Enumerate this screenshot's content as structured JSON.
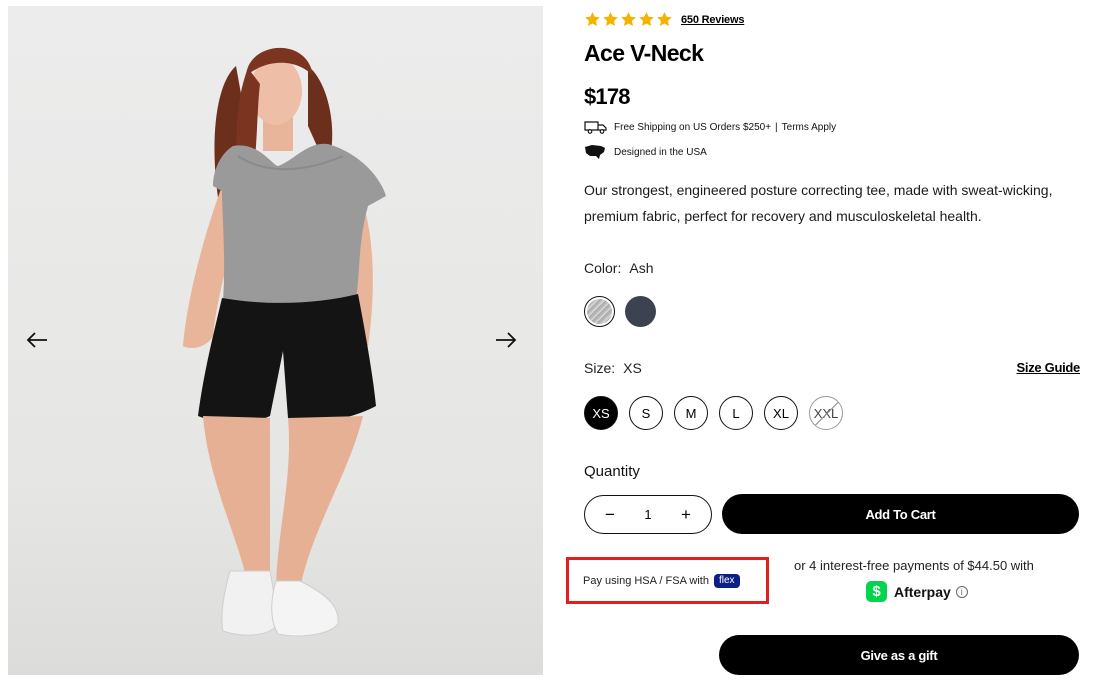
{
  "product": {
    "rating_stars": 5,
    "reviews_label": "650 Reviews",
    "title": "Ace V-Neck",
    "price": "$178",
    "shipping": {
      "text": "Free Shipping on US Orders $250+",
      "separator": "|",
      "terms": "Terms Apply",
      "icon": "truck-icon"
    },
    "origin": {
      "text": "Designed in the USA",
      "icon": "usa-map-icon"
    },
    "description": "Our strongest, engineered posture correcting tee, made with sweat-wicking, premium fabric, perfect for recovery and musculoskeletal health."
  },
  "color": {
    "label": "Color:",
    "selected": "Ash",
    "options": [
      {
        "name": "Ash",
        "hex": "#bcbcbc",
        "selected": true
      },
      {
        "name": "Navy",
        "hex": "#3d4250",
        "selected": false
      }
    ]
  },
  "size": {
    "label": "Size:",
    "selected": "XS",
    "guide_label": "Size Guide",
    "options": [
      {
        "label": "XS",
        "state": "selected"
      },
      {
        "label": "S",
        "state": "available"
      },
      {
        "label": "M",
        "state": "available"
      },
      {
        "label": "L",
        "state": "available"
      },
      {
        "label": "XL",
        "state": "available"
      },
      {
        "label": "XXL",
        "state": "sold-out"
      }
    ]
  },
  "quantity": {
    "label": "Quantity",
    "value": "1",
    "minus": "−",
    "plus": "+"
  },
  "cart": {
    "add_label": "Add To Cart",
    "gift_label": "Give as a gift"
  },
  "payments": {
    "hsa_text": "Pay using HSA / FSA with",
    "hsa_badge": "flex",
    "afterpay_text": "or 4 interest-free payments of $44.50 with",
    "afterpay_name": "Afterpay",
    "cashapp_symbol": "$",
    "info_symbol": "i"
  },
  "colors": {
    "accent": "#000000",
    "highlight_border": "#e02020",
    "flex_badge": "#0c1f86",
    "cashapp": "#00d54b",
    "star": "#f5b301"
  }
}
